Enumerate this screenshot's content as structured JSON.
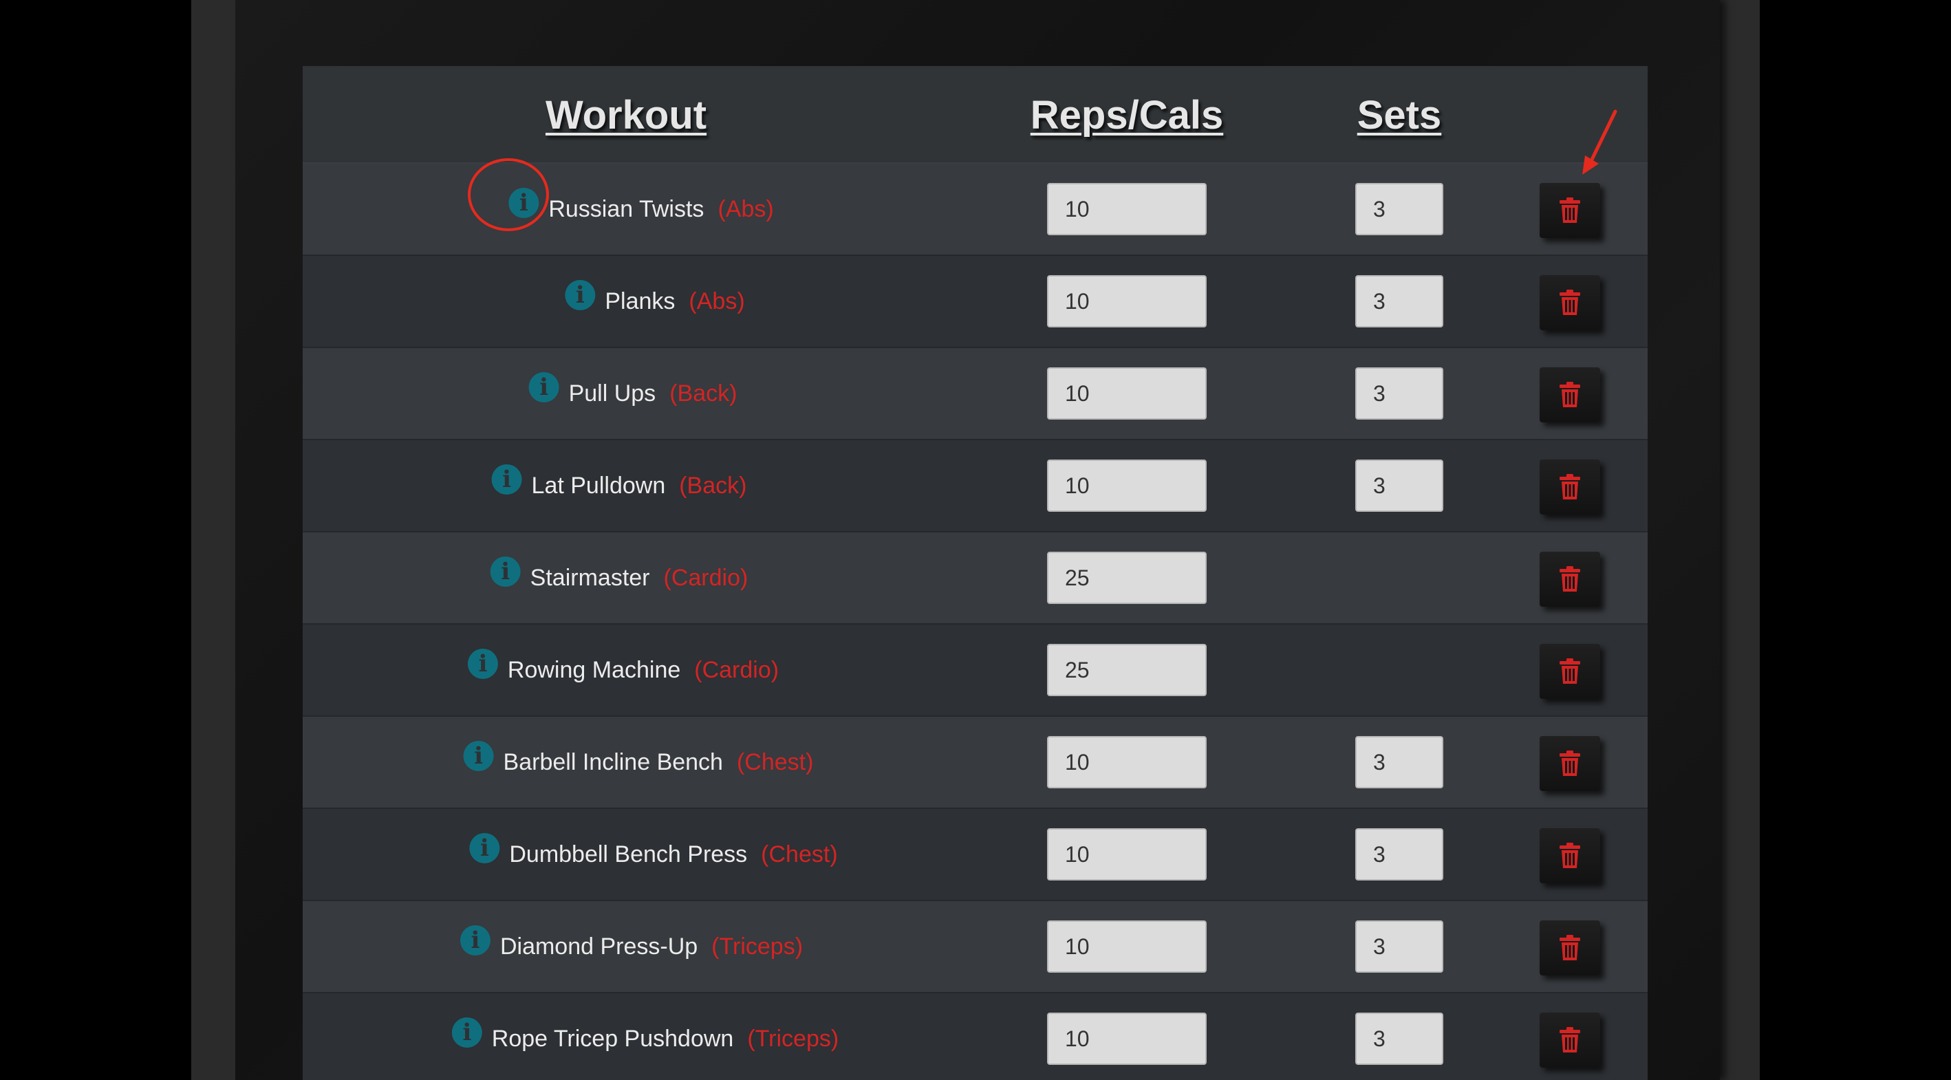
{
  "table": {
    "headers": {
      "workout": "Workout",
      "reps": "Reps/Cals",
      "sets": "Sets"
    },
    "rows": [
      {
        "name": "Russian Twists",
        "category": "(Abs)",
        "reps": "10",
        "sets": "3"
      },
      {
        "name": "Planks",
        "category": "(Abs)",
        "reps": "10",
        "sets": "3"
      },
      {
        "name": "Pull Ups",
        "category": "(Back)",
        "reps": "10",
        "sets": "3"
      },
      {
        "name": "Lat Pulldown",
        "category": "(Back)",
        "reps": "10",
        "sets": "3"
      },
      {
        "name": "Stairmaster",
        "category": "(Cardio)",
        "reps": "25",
        "sets": null
      },
      {
        "name": "Rowing Machine",
        "category": "(Cardio)",
        "reps": "25",
        "sets": null
      },
      {
        "name": "Barbell Incline Bench",
        "category": "(Chest)",
        "reps": "10",
        "sets": "3"
      },
      {
        "name": "Dumbbell Bench Press",
        "category": "(Chest)",
        "reps": "10",
        "sets": "3"
      },
      {
        "name": "Diamond Press-Up",
        "category": "(Triceps)",
        "reps": "10",
        "sets": "3"
      },
      {
        "name": "Rope Tricep Pushdown",
        "category": "(Triceps)",
        "reps": "10",
        "sets": "3"
      }
    ]
  },
  "icons": {
    "info": "info-circle-icon",
    "delete": "trash-icon",
    "info_glyph": "i"
  },
  "colors": {
    "accent_red": "#d42424",
    "info_teal": "#0f6f7f",
    "annotation_red": "#e52a1e",
    "panel_bg": "#2e3134"
  }
}
